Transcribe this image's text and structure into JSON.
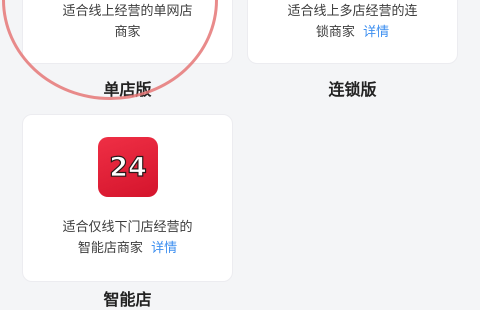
{
  "plans": [
    {
      "name": "单店版",
      "desc_line1": "适合线上经营的单网店",
      "desc_line2": "商家"
    },
    {
      "name": "连锁版",
      "desc_line1": "适合线上多店经营的连",
      "desc_line2": "锁商家",
      "detail": "详情"
    },
    {
      "name": "智能店",
      "desc_line1": "适合仅线下门店经营的",
      "desc_line2": "智能店商家",
      "detail": "详情",
      "logo_text": "24",
      "logo_color": "#e8253c"
    }
  ],
  "highlight_color": "#e57777"
}
